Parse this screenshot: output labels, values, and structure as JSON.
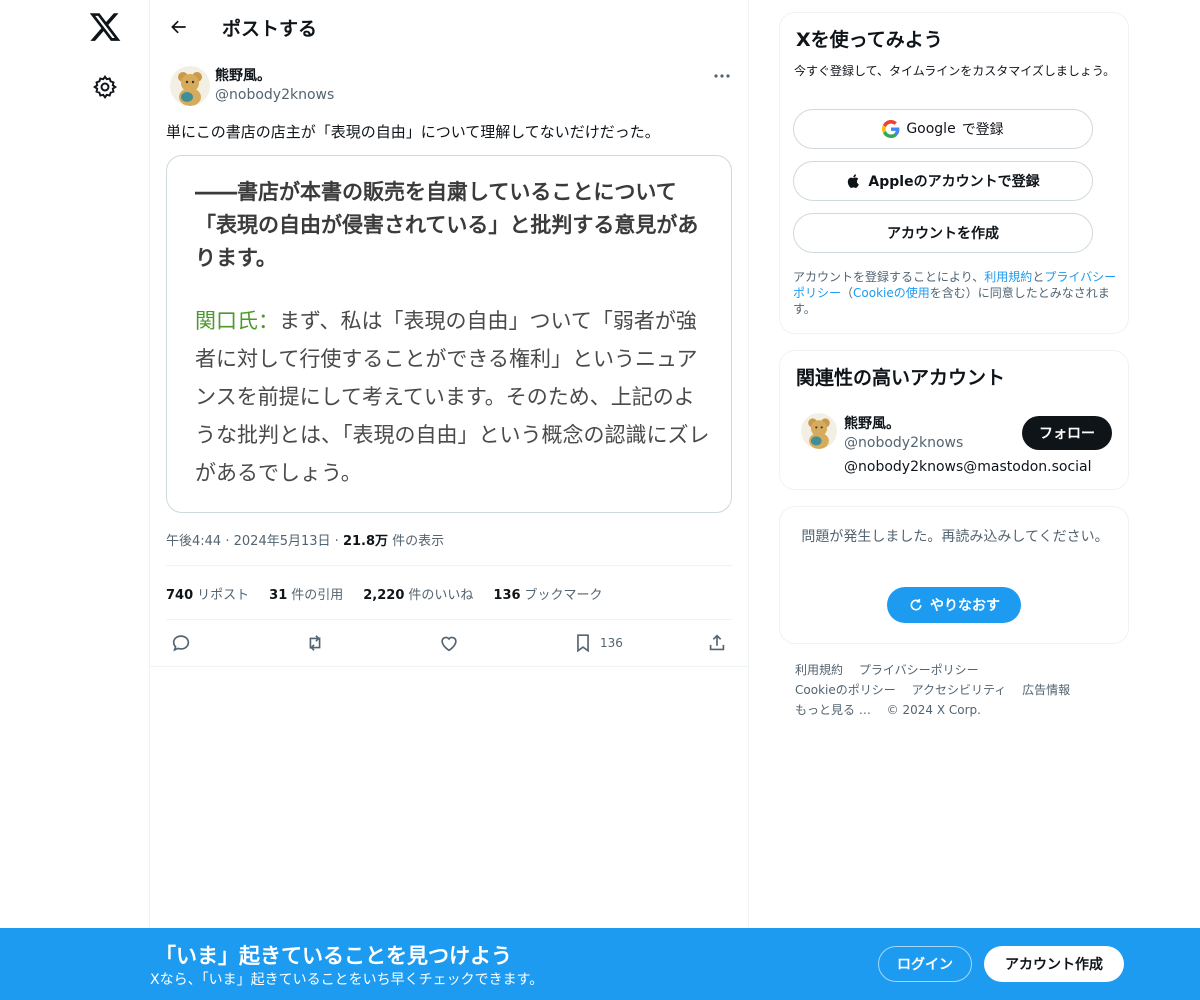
{
  "nav": {
    "logo_icon": "x-logo-icon",
    "settings_icon": "gear-icon"
  },
  "header": {
    "title": "ポストする"
  },
  "post": {
    "author_name": "熊野風。",
    "author_handle": "@nobody2knows",
    "text": "単にこの書店の店主が「表現の自由」について理解してないだけだった。",
    "image": {
      "question": "――書店が本書の販売を自粛していることについて「表現の自由が侵害されている」と批判する意見があります。",
      "speaker": "関口氏：",
      "answer": "まず、私は「表現の自由」ついて「弱者が強者に対して行使することができる権利」というニュアンスを前提にして考えています。そのため、上記のような批判とは、「表現の自由」という概念の認識にズレがあるでしょう。"
    },
    "time": "午後4:44",
    "sep": "·",
    "date": "2024年5月13日",
    "views_count": "21.8万",
    "views_label": "件の表示",
    "stats": {
      "reposts_count": "740",
      "reposts_label": "リポスト",
      "quotes_count": "31",
      "quotes_label": "件の引用",
      "likes_count": "2,220",
      "likes_label": "件のいいね",
      "bookmarks_count": "136",
      "bookmarks_label": "ブックマーク"
    },
    "bookmark_action_count": "136"
  },
  "signup_card": {
    "title": "Xを使ってみよう",
    "subtitle": "今すぐ登録して、タイムラインをカスタマイズしましょう。",
    "google_brand": "Google",
    "google_label": "で登録",
    "apple_label": "Appleのアカウントで登録",
    "create_label": "アカウントを作成",
    "legal_1": "アカウントを登録することにより、",
    "legal_terms": "利用規約",
    "legal_and": "と",
    "legal_privacy": "プライバシーポリシー",
    "legal_2": "（",
    "legal_cookie": "Cookieの使用",
    "legal_3": "を含む）に同意したとみなされます。"
  },
  "relevant": {
    "title": "関連性の高いアカウント",
    "name": "熊野風。",
    "handle": "@nobody2knows",
    "bio": "@nobody2knows@mastodon.social",
    "follow_label": "フォロー"
  },
  "error_card": {
    "message": "問題が発生しました。再読み込みしてください。",
    "retry_label": "やりなおす"
  },
  "footer": {
    "links": [
      "利用規約",
      "プライバシーポリシー",
      "Cookieのポリシー",
      "アクセシビリティ",
      "広告情報",
      "もっと見る …",
      "© 2024 X Corp."
    ]
  },
  "bottom_bar": {
    "title": "「いま」起きていることを見つけよう",
    "subtitle": "Xなら、「いま」起きていることをいち早くチェックできます。",
    "login_label": "ログイン",
    "signup_label": "アカウント作成"
  },
  "colors": {
    "accent": "#1d9bf0",
    "text": "#0f1419",
    "muted": "#536471",
    "speaker_green": "#4c9a2a"
  }
}
